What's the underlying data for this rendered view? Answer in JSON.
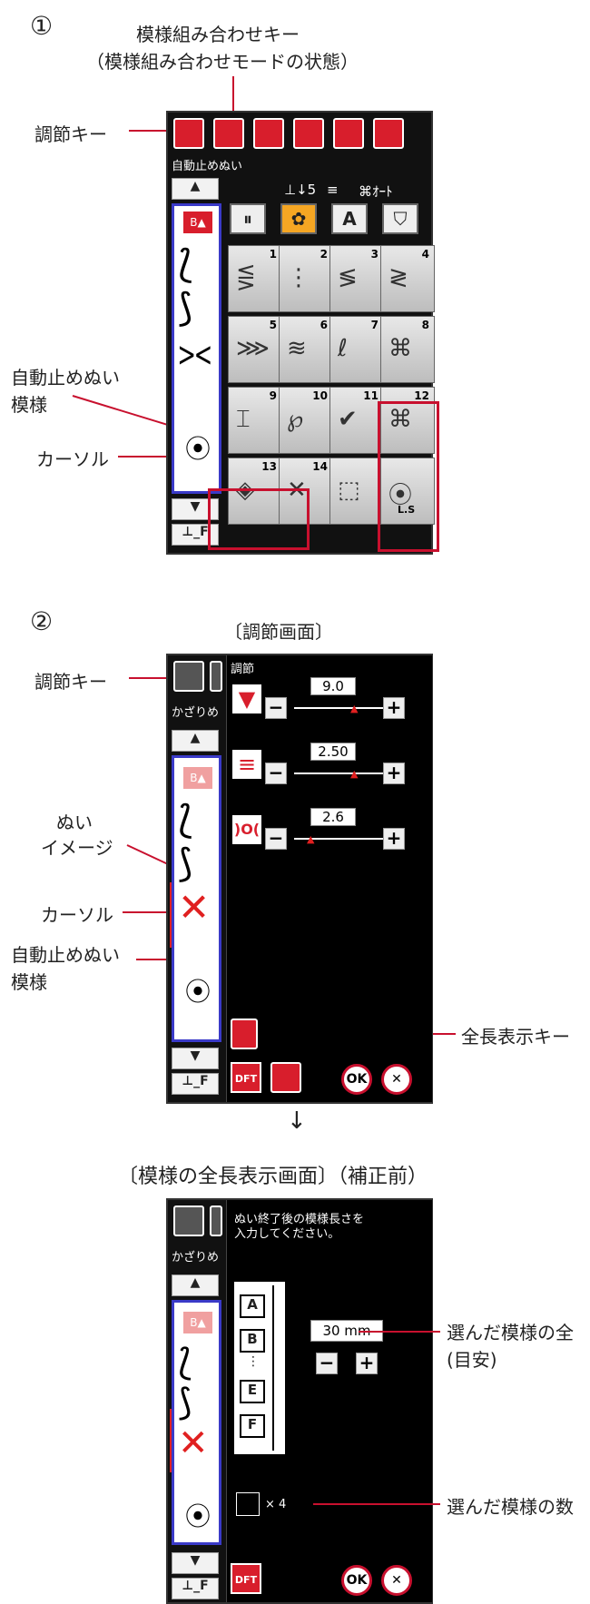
{
  "section1": {
    "number": "①",
    "combo_key_label_1": "模様組み合わせキー",
    "combo_key_label_2": "（模様組み合わせモードの状態）",
    "adjust_key_label": "調節キー",
    "auto_stop_label_1": "自動止めぬい",
    "auto_stop_label_2": "模様",
    "cursor_label": "カーソル",
    "screen_title": "自動止めぬい",
    "status_presser": "5",
    "status_auto": "ｵｰﾄ",
    "tab_letter": "A",
    "keys": [
      {
        "num": "1",
        "glyph": "⋚"
      },
      {
        "num": "2",
        "glyph": "⋮"
      },
      {
        "num": "3",
        "glyph": "≶"
      },
      {
        "num": "4",
        "glyph": "≷"
      },
      {
        "num": "5",
        "glyph": "⋙"
      },
      {
        "num": "6",
        "glyph": "≋"
      },
      {
        "num": "7",
        "glyph": "ℓ"
      },
      {
        "num": "8",
        "glyph": "⌘"
      },
      {
        "num": "9",
        "glyph": "⌶"
      },
      {
        "num": "10",
        "glyph": "℘"
      },
      {
        "num": "11",
        "glyph": "✔"
      },
      {
        "num": "12",
        "glyph": "⌘"
      },
      {
        "num": "13",
        "glyph": "◈"
      },
      {
        "num": "14",
        "glyph": "✕"
      },
      {
        "num": "",
        "glyph": "⬚"
      },
      {
        "num": "",
        "glyph": "⦿"
      }
    ],
    "ls_label": "L.S"
  },
  "section2": {
    "number": "②",
    "screen_caption": "〔調節画面〕",
    "adjust_key_label": "調節キー",
    "stitch_image_label_1": "ぬい",
    "stitch_image_label_2": "イメージ",
    "cursor_label": "カーソル",
    "auto_stop_label_1": "自動止めぬい",
    "auto_stop_label_2": "模様",
    "full_length_key_label": "全長表示キー",
    "screen_header": "調節",
    "side_title": "かざりめ",
    "width_value": "9.0",
    "length_value": "2.50",
    "tension_value": "2.6",
    "dft_label": "DFT",
    "ok_label": "OK",
    "cancel_label": "✕"
  },
  "section3": {
    "arrow": "↓",
    "caption": "〔模様の全長表示画面〕（補正前）",
    "instruction_1": "ぬい終了後の模様長さを",
    "instruction_2": "入力してください。",
    "side_title": "かざりめ",
    "length_value": "30 mm",
    "repeat_label": "× 4",
    "selected_length_label_1": "選んだ模様の全",
    "selected_length_label_2": "(目安)",
    "selected_count_label": "選んだ模様の数",
    "letters": [
      "A",
      "B",
      "E",
      "F"
    ],
    "dft_label": "DFT",
    "ok_label": "OK",
    "cancel_label": "✕"
  }
}
